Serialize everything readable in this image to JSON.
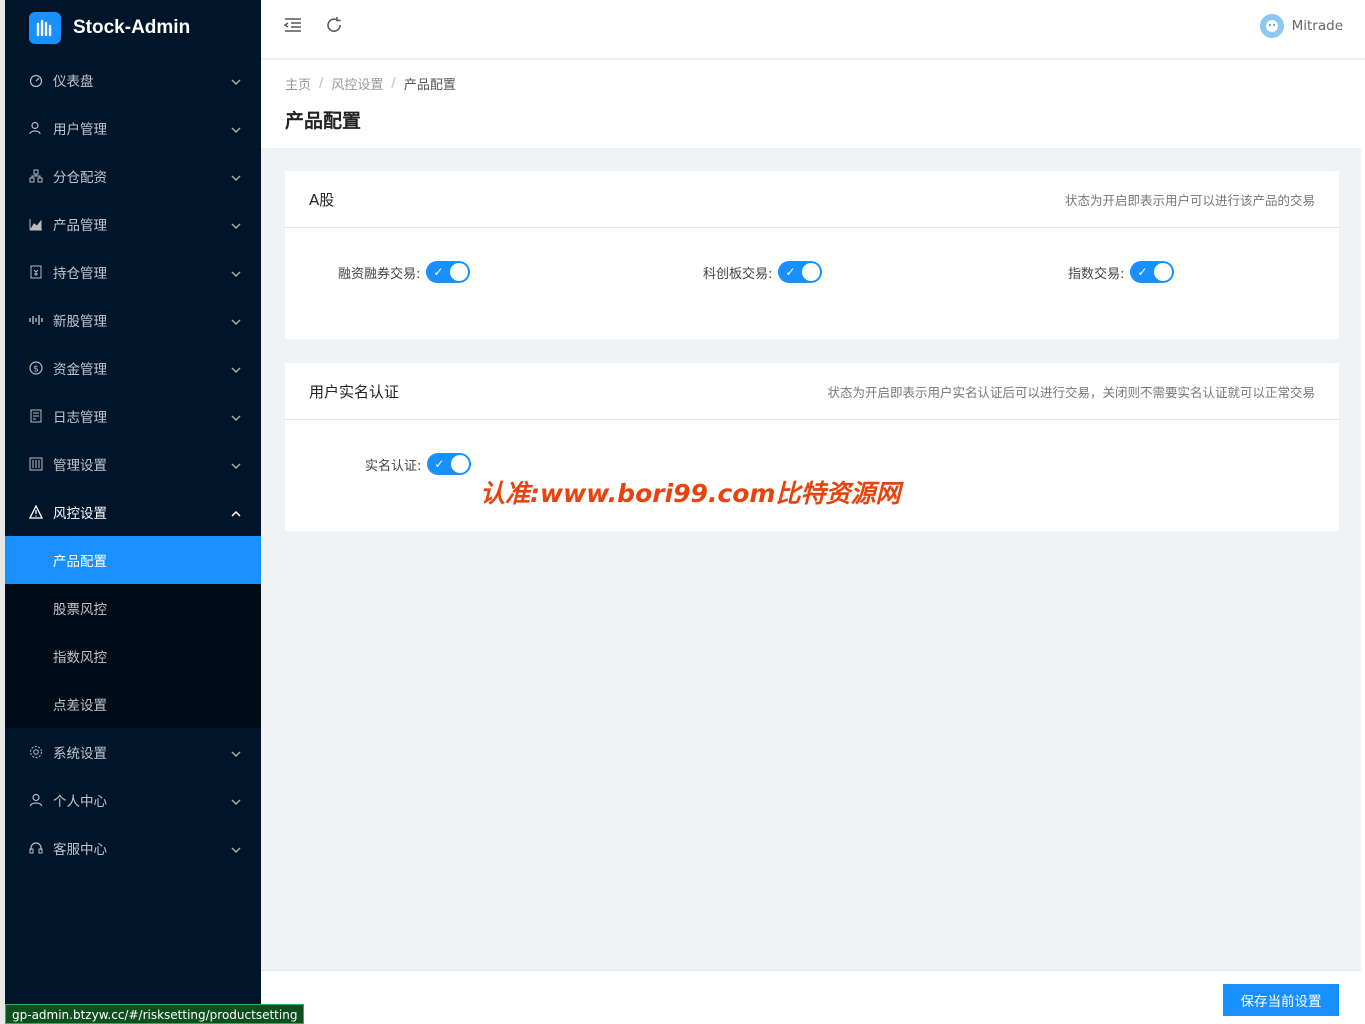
{
  "app": {
    "title": "Stock-Admin"
  },
  "sidebar": {
    "items": [
      {
        "label": "仪表盘",
        "icon": "dashboard-icon"
      },
      {
        "label": "用户管理",
        "icon": "user-manage-icon"
      },
      {
        "label": "分仓配资",
        "icon": "cluster-icon"
      },
      {
        "label": "产品管理",
        "icon": "area-chart-icon"
      },
      {
        "label": "持仓管理",
        "icon": "position-icon"
      },
      {
        "label": "新股管理",
        "icon": "sound-icon"
      },
      {
        "label": "资金管理",
        "icon": "dollar-icon"
      },
      {
        "label": "日志管理",
        "icon": "log-icon"
      },
      {
        "label": "管理设置",
        "icon": "control-icon"
      },
      {
        "label": "风控设置",
        "icon": "warning-icon",
        "open": true
      },
      {
        "label": "系统设置",
        "icon": "setting-icon"
      },
      {
        "label": "个人中心",
        "icon": "person-icon"
      },
      {
        "label": "客服中心",
        "icon": "headset-icon"
      }
    ],
    "submenu": [
      {
        "label": "产品配置",
        "active": true
      },
      {
        "label": "股票风控"
      },
      {
        "label": "指数风控"
      },
      {
        "label": "点差设置"
      }
    ]
  },
  "header": {
    "user_name": "Mitrade"
  },
  "breadcrumb": {
    "home": "主页",
    "parent": "风控设置",
    "current": "产品配置",
    "sep": "/"
  },
  "page": {
    "title": "产品配置"
  },
  "card_a": {
    "title": "A股",
    "extra": "状态为开启即表示用户可以进行该产品的交易",
    "fields": [
      {
        "label": "融资融券交易:",
        "on": true
      },
      {
        "label": "科创板交易:",
        "on": true
      },
      {
        "label": "指数交易:",
        "on": true
      }
    ]
  },
  "card_realname": {
    "title": "用户实名认证",
    "extra": "状态为开启即表示用户实名认证后可以进行交易，关闭则不需要实名认证就可以正常交易",
    "fields": [
      {
        "label": "实名认证:",
        "on": true
      }
    ]
  },
  "watermark": "认准:www.bori99.com比特资源网",
  "footer": {
    "save_label": "保存当前设置"
  },
  "status_url": "gp-admin.btzyw.cc/#/risksetting/productsetting",
  "colors": {
    "primary": "#1890ff",
    "sidebar_bg": "#001529",
    "watermark": "#e8430f"
  }
}
